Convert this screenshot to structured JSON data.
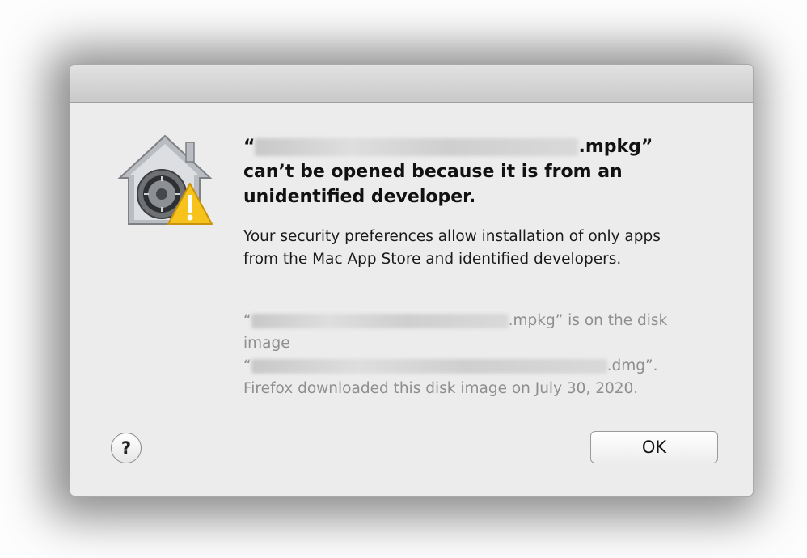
{
  "dialog": {
    "title_open_quote": "“",
    "title_filename_suffix": ".mpkg”",
    "title_rest": "can’t be opened because it is from an unidentified developer.",
    "info_text": "Your security preferences allow installation of only apps from the Mac App Store and identified developers.",
    "details": {
      "open_quote_1": "“",
      "line1_suffix": ".mpkg” is on the disk image",
      "open_quote_2": "“",
      "line2_suffix": ".dmg”.",
      "download_note": "Firefox downloaded this disk image on July 30, 2020."
    },
    "icons": {
      "main": "gatekeeper-security-icon",
      "warning": "warning-triangle-icon"
    }
  },
  "buttons": {
    "help_label": "?",
    "ok_label": "OK"
  },
  "colors": {
    "dialog_bg": "#ececec",
    "secondary_text": "#8e8e8e",
    "warning_yellow": "#f5c31b"
  }
}
